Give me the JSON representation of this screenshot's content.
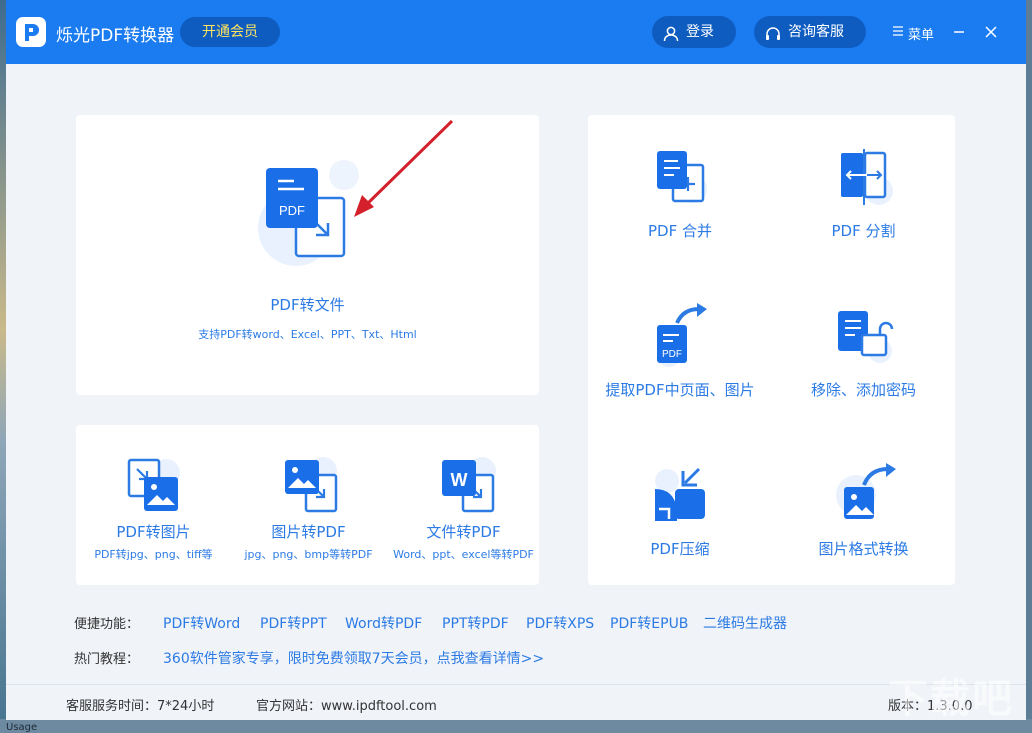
{
  "colors": {
    "brand_blue": "#1a7cf0",
    "accent_dark": "#0e5cc0",
    "link_blue": "#2c7be5",
    "vip_text": "#ffe45c"
  },
  "titlebar": {
    "app_title": "烁光PDF转换器",
    "vip_label": "开通会员",
    "login_label": "登录",
    "service_label": "咨询客服",
    "menu_label": "菜单"
  },
  "main_tool": {
    "label": "PDF转文件",
    "sub": "支持PDF转word、Excel、PPT、Txt、Html",
    "icon_text": "PDF"
  },
  "bottom_tools": [
    {
      "label": "PDF转图片",
      "sub": "PDF转jpg、png、tiff等"
    },
    {
      "label": "图片转PDF",
      "sub": "jpg、png、bmp等转PDF"
    },
    {
      "label": "文件转PDF",
      "sub": "Word、ppt、excel等转PDF",
      "icon_text": "W"
    }
  ],
  "right_tools": [
    {
      "label": "PDF 合并"
    },
    {
      "label": "PDF 分割"
    },
    {
      "label": "提取PDF中页面、图片",
      "icon_text": "PDF"
    },
    {
      "label": "移除、添加密码"
    },
    {
      "label": "PDF压缩"
    },
    {
      "label": "图片格式转换"
    }
  ],
  "shortcuts": {
    "label": "便捷功能：",
    "links": [
      "PDF转Word",
      "PDF转PPT",
      "Word转PDF",
      "PPT转PDF",
      "PDF转XPS",
      "PDF转EPUB",
      "二维码生成器"
    ]
  },
  "tutorials": {
    "label": "热门教程：",
    "link": "360软件管家专享，限时免费领取7天会员，点我查看详情>>"
  },
  "footer": {
    "hours": "客服服务时间：7*24小时",
    "site": "官方网站：www.ipdftool.com",
    "version": "版本：1.3.0.0"
  },
  "desktop": {
    "usage_text": "Usage",
    "watermark": "下载吧"
  }
}
